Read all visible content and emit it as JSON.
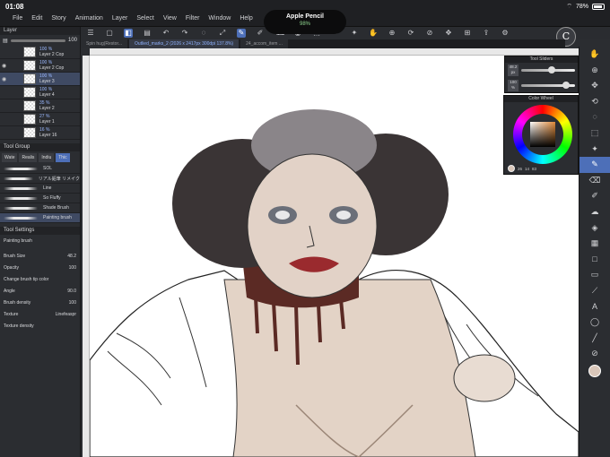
{
  "status": {
    "time": "01:08",
    "battery": "78%"
  },
  "menu": [
    "File",
    "Edit",
    "Story",
    "Animation",
    "Layer",
    "Select",
    "View",
    "Filter",
    "Window",
    "Help"
  ],
  "pencil_popup": {
    "title": "Apple Pencil",
    "charge": "98%"
  },
  "toolbar_icons": [
    "menu-icon",
    "new-icon",
    "open-icon",
    "save-icon",
    "undo-icon",
    "redo-icon",
    "lasso-icon",
    "transform-icon",
    "pen-icon",
    "brush-icon",
    "eraser-icon",
    "fill-icon",
    "select-icon",
    "crop-icon",
    "wand-icon",
    "hand-icon",
    "zoom-icon",
    "rotate-icon",
    "eyedropper-icon",
    "move-icon",
    "grid-icon",
    "share-icon",
    "settings-icon"
  ],
  "doc_tabs": [
    {
      "label": "Spin hug(Restor...",
      "active": false
    },
    {
      "label": "Outlied_marks_2 (2026 x 2417px 300dpi 137.8%)",
      "active": true
    },
    {
      "label": "24_accom_item ...",
      "active": false
    }
  ],
  "layer_panel": {
    "title": "Layer",
    "opacity": "100",
    "layers": [
      {
        "pct": "100 %",
        "mode": "Nor",
        "name": "Layer 2 Cop",
        "visible": false,
        "selected": false
      },
      {
        "pct": "100 %",
        "mode": "",
        "name": "Layer 2 Cop",
        "visible": true,
        "selected": false
      },
      {
        "pct": "100 %",
        "mode": "Nor",
        "name": "Layer 3",
        "visible": true,
        "selected": true
      },
      {
        "pct": "100 %",
        "mode": "Nor",
        "name": "Layer 4",
        "visible": false,
        "selected": false
      },
      {
        "pct": "35 %",
        "mode": "",
        "name": "Layer 2",
        "visible": false,
        "selected": false
      },
      {
        "pct": "27 %",
        "mode": "",
        "name": "Layer 1",
        "visible": false,
        "selected": false
      },
      {
        "pct": "16 %",
        "mode": "Nor",
        "name": "Layer 16",
        "visible": false,
        "selected": false
      }
    ]
  },
  "subtool": {
    "title": "Tool Group",
    "tabs": [
      "Wate",
      "Realis",
      "Indiu",
      "Thic"
    ],
    "brushes": [
      "SOL",
      "リアル鉛筆 リメイク",
      "Line",
      "So Fluffy",
      "Shade Brush",
      "Painting brush"
    ]
  },
  "tool_settings": {
    "title": "Tool Settings",
    "brush_name": "Painting brush",
    "props": [
      {
        "label": "Brush Size",
        "value": "48.2"
      },
      {
        "label": "Opacity",
        "value": "100"
      },
      {
        "label": "Change brush tip color",
        "value": ""
      },
      {
        "label": "Angle",
        "value": "90.0"
      },
      {
        "label": "Brush density",
        "value": "100"
      },
      {
        "label": "Texture",
        "value": "Linefeaspr"
      },
      {
        "label": "Texture density",
        "value": ""
      }
    ]
  },
  "slider_panel": {
    "title": "Tool Sliders",
    "size_value": "48.2",
    "size_unit": "px",
    "opacity_value": "100",
    "opacity_unit": "%"
  },
  "color_wheel": {
    "title": "Color Wheel",
    "h": "26",
    "s": "14",
    "v": "83",
    "current_color": "#d9c6b9"
  },
  "right_tools": [
    "hand-icon",
    "zoom-icon",
    "move-icon",
    "rotate-icon",
    "lasso-icon",
    "select-icon",
    "wand-icon",
    "pen-icon",
    "eraser-icon",
    "brush-icon",
    "blend-icon",
    "fill-icon",
    "gradient-icon",
    "shape-icon",
    "frame-icon",
    "ruler-icon",
    "text-icon",
    "balloon-icon",
    "line-icon",
    "eyedropper-icon",
    "layer-fill-icon"
  ]
}
